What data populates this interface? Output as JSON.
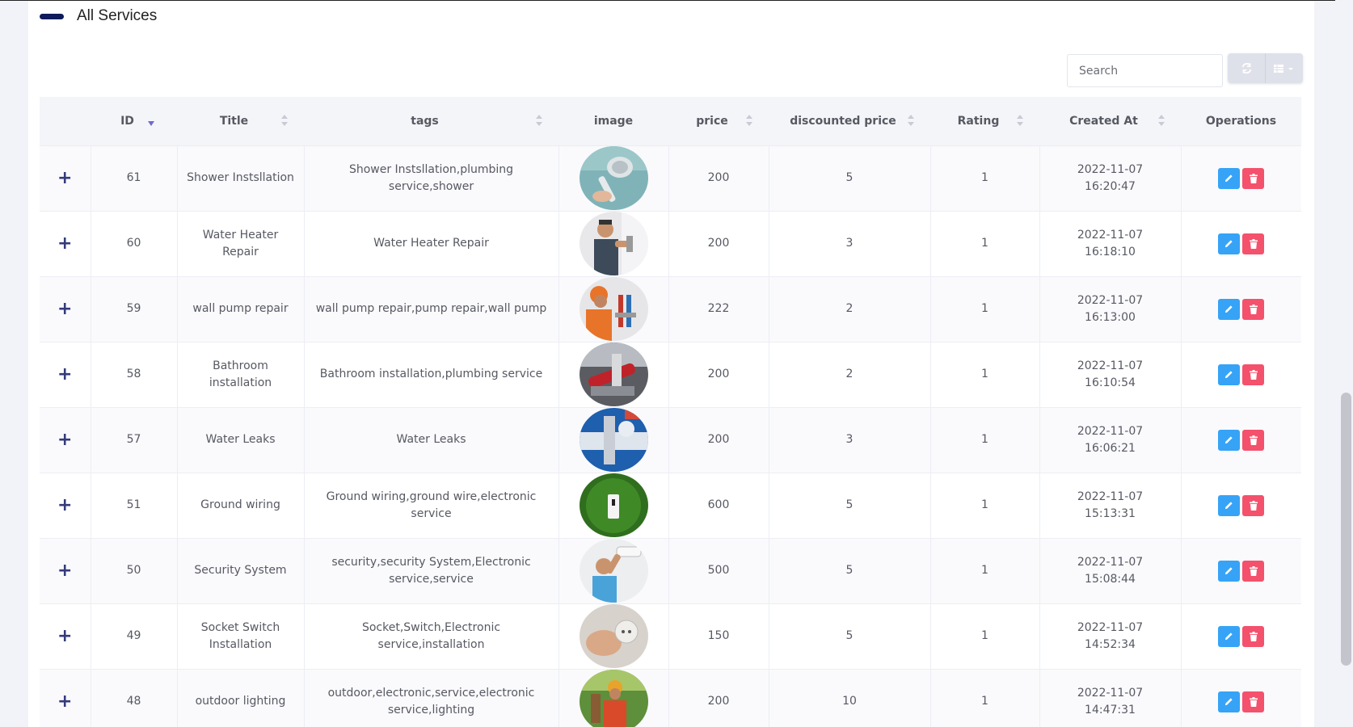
{
  "header": {
    "title": "All Services"
  },
  "toolbar": {
    "search_placeholder": "Search"
  },
  "colors": {
    "accent": "#0f1a5c",
    "edit": "#36a3f7",
    "delete": "#f4516c",
    "expand": "#333b7a"
  },
  "table": {
    "columns": [
      "ID",
      "Title",
      "tags",
      "image",
      "price",
      "discounted price",
      "Rating",
      "Created At",
      "Operations"
    ],
    "rows": [
      {
        "expand": "+",
        "id": "61",
        "title": "Shower Instsllation",
        "tags": "Shower Instsllation,plumbing service,shower",
        "image": "shower-head-photo",
        "price": "200",
        "discounted_price": "5",
        "rating": "1",
        "created_date": "2022-11-07",
        "created_time": "16:20:47"
      },
      {
        "expand": "+",
        "id": "60",
        "title": "Water Heater Repair",
        "tags": "Water Heater Repair",
        "image": "water-heater-technician-photo",
        "price": "200",
        "discounted_price": "3",
        "rating": "1",
        "created_date": "2022-11-07",
        "created_time": "16:18:10"
      },
      {
        "expand": "+",
        "id": "59",
        "title": "wall pump repair",
        "tags": "wall pump repair,pump repair,wall pump",
        "image": "pump-technician-photo",
        "price": "222",
        "discounted_price": "2",
        "rating": "1",
        "created_date": "2022-11-07",
        "created_time": "16:13:00"
      },
      {
        "expand": "+",
        "id": "58",
        "title": "Bathroom installation",
        "tags": "Bathroom installation,plumbing service",
        "image": "bathroom-pipe-wrench-photo",
        "price": "200",
        "discounted_price": "2",
        "rating": "1",
        "created_date": "2022-11-07",
        "created_time": "16:10:54"
      },
      {
        "expand": "+",
        "id": "57",
        "title": "Water Leaks",
        "tags": "Water Leaks",
        "image": "water-leak-pipe-photo",
        "price": "200",
        "discounted_price": "3",
        "rating": "1",
        "created_date": "2022-11-07",
        "created_time": "16:06:21"
      },
      {
        "expand": "+",
        "id": "51",
        "title": "Ground wiring",
        "tags": "Ground wiring,ground wire,electronic service",
        "image": "ground-outlet-grass-photo",
        "price": "600",
        "discounted_price": "5",
        "rating": "1",
        "created_date": "2022-11-07",
        "created_time": "15:13:31"
      },
      {
        "expand": "+",
        "id": "50",
        "title": "Security System",
        "tags": "security,security System,Electronic service,service",
        "image": "security-camera-install-photo",
        "price": "500",
        "discounted_price": "5",
        "rating": "1",
        "created_date": "2022-11-07",
        "created_time": "15:08:44"
      },
      {
        "expand": "+",
        "id": "49",
        "title": "Socket Switch Installation",
        "tags": "Socket,Switch,Electronic service,installation",
        "image": "socket-hand-photo",
        "price": "150",
        "discounted_price": "5",
        "rating": "1",
        "created_date": "2022-11-07",
        "created_time": "14:52:34"
      },
      {
        "expand": "+",
        "id": "48",
        "title": "outdoor lighting",
        "tags": "outdoor,electronic,service,electronic service,lighting",
        "image": "outdoor-lighting-worker-photo",
        "price": "200",
        "discounted_price": "10",
        "rating": "1",
        "created_date": "2022-11-07",
        "created_time": "14:47:31"
      }
    ]
  }
}
